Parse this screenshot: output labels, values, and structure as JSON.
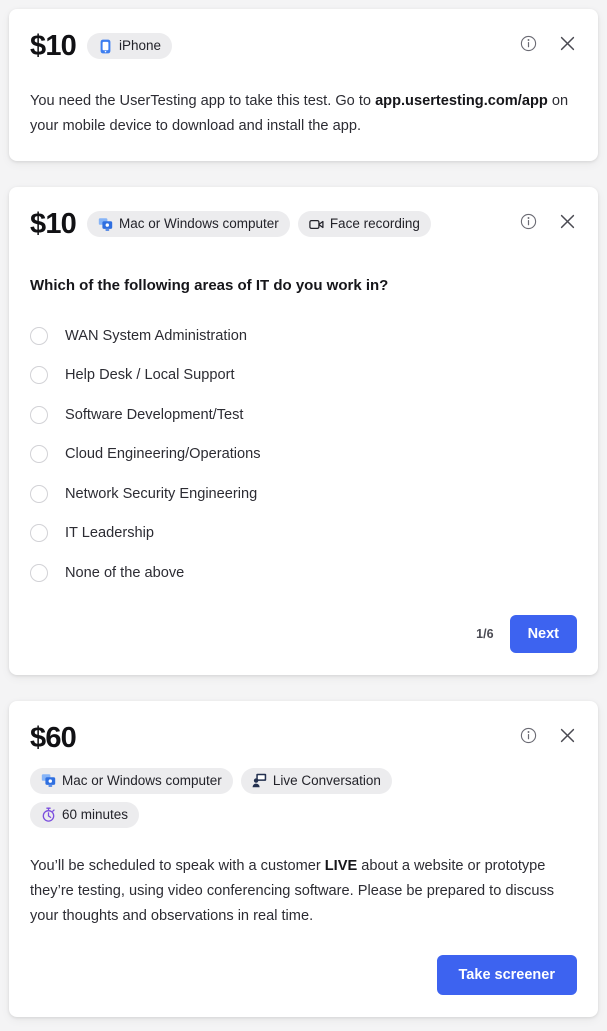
{
  "cards": [
    {
      "price": "$10",
      "badges": [
        {
          "icon": "iphone-icon",
          "label": "iPhone"
        }
      ],
      "body_lead": "You need the UserTesting app to take this test. Go to ",
      "body_bold": "app.usertesting.com/app",
      "body_tail": " on your mobile device to download and install the app.",
      "info_icon": "info-icon",
      "close_icon": "close-icon"
    },
    {
      "price": "$10",
      "badges": [
        {
          "icon": "computer-icon",
          "label": "Mac or Windows computer"
        },
        {
          "icon": "face-recording-icon",
          "label": "Face recording"
        }
      ],
      "question": "Which of the following areas of IT do you work in?",
      "options": [
        "WAN System Administration",
        "Help Desk / Local Support",
        "Software Development/Test",
        "Cloud Engineering/Operations",
        "Network Security Engineering",
        "IT Leadership",
        "None of the above"
      ],
      "counter": "1/6",
      "next_label": "Next",
      "info_icon": "info-icon",
      "close_icon": "close-icon"
    },
    {
      "price": "$60",
      "badges": [
        {
          "icon": "computer-icon",
          "label": "Mac or Windows computer"
        },
        {
          "icon": "live-conversation-icon",
          "label": "Live Conversation"
        },
        {
          "icon": "stopwatch-icon",
          "label": "60 minutes"
        }
      ],
      "body_lead": "You’ll be scheduled to speak with a customer ",
      "body_bold": "LIVE",
      "body_tail": " about a website or prototype they’re testing, using video conferencing software. Please be prepared to discuss your thoughts and observations in real time.",
      "take_screener_label": "Take screener",
      "info_icon": "info-icon",
      "close_icon": "close-icon"
    }
  ],
  "colors": {
    "page_background": "#f4f4f5",
    "card_background": "#ffffff",
    "primary_button": "#3d63f0",
    "badge_background": "#ececee",
    "text": "#2c2c33",
    "icon_blue": "#3d7ef0",
    "icon_purple": "#7b4ede",
    "icon_navy": "#23304f"
  }
}
